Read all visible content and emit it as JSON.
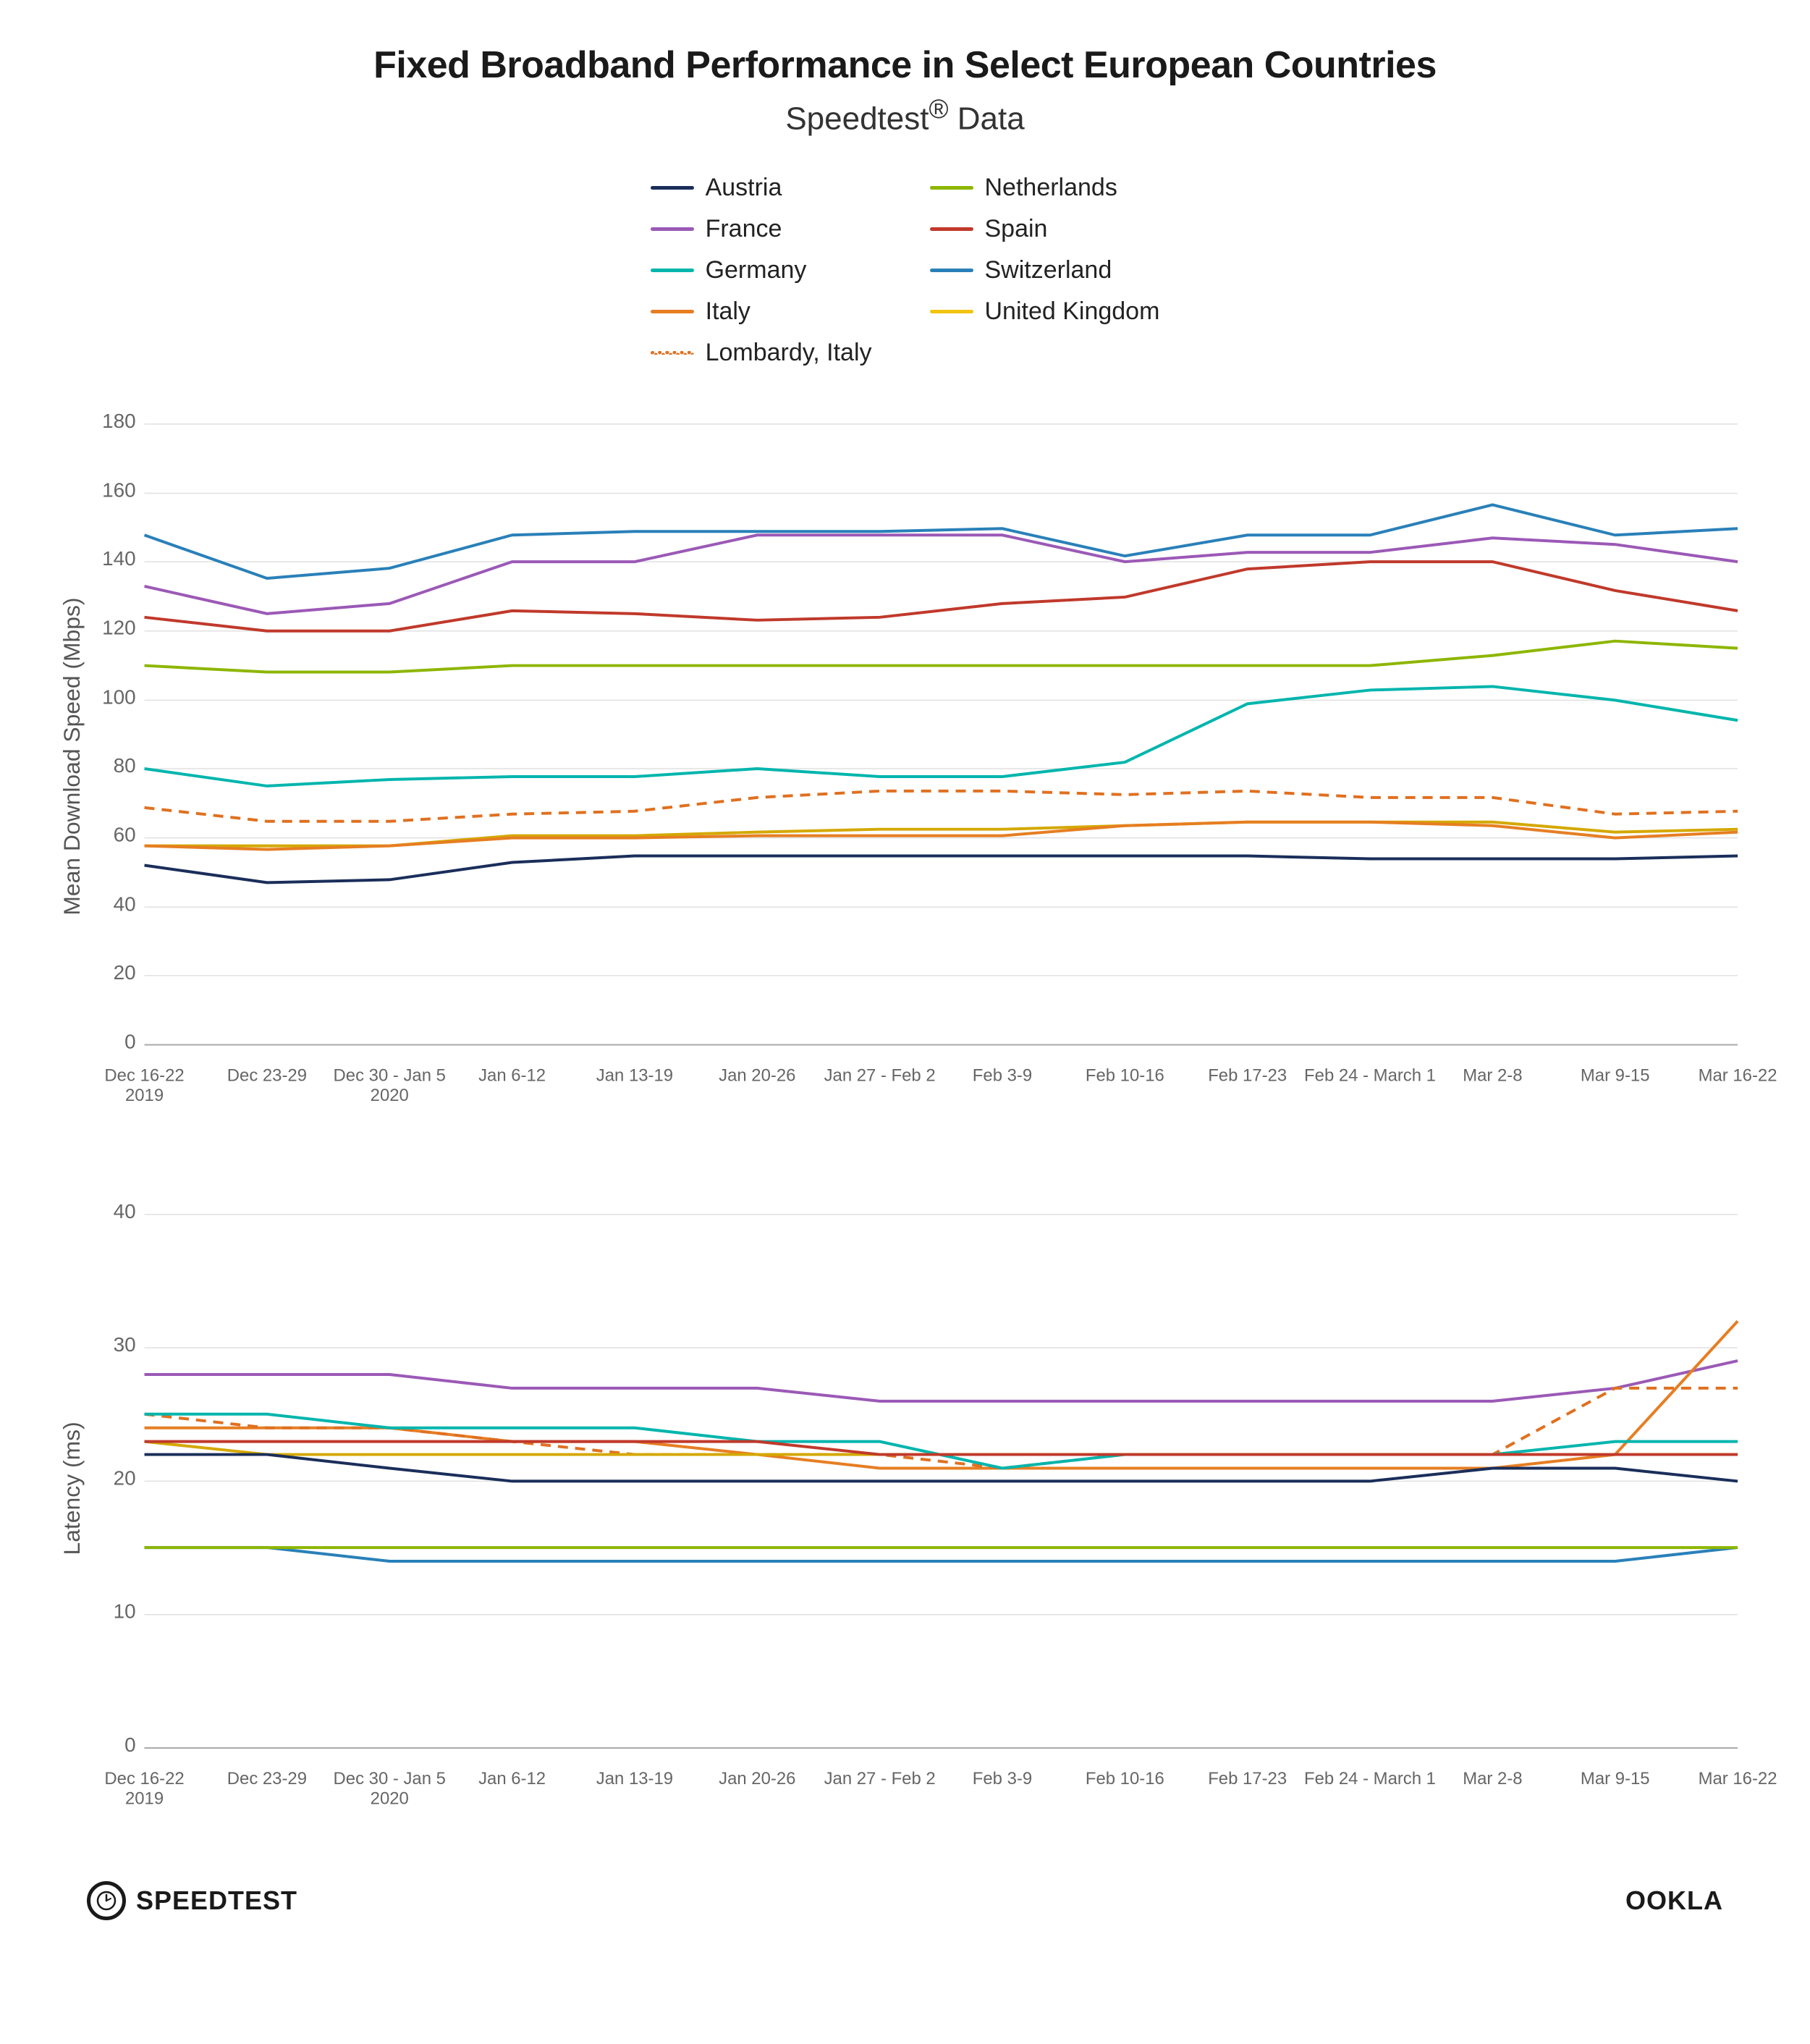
{
  "title": "Fixed Broadband Performance in Select European Countries",
  "subtitle": "Speedtest® Data",
  "legend": {
    "items": [
      {
        "label": "Austria",
        "color": "#1a2e5a",
        "style": "solid"
      },
      {
        "label": "Netherlands",
        "color": "#8db600",
        "style": "solid"
      },
      {
        "label": "France",
        "color": "#9b59b6",
        "style": "solid"
      },
      {
        "label": "Spain",
        "color": "#c0392b",
        "style": "solid"
      },
      {
        "label": "Germany",
        "color": "#00b5ad",
        "style": "solid"
      },
      {
        "label": "Switzerland",
        "color": "#2980b9",
        "style": "solid"
      },
      {
        "label": "Italy",
        "color": "#e67e22",
        "style": "solid"
      },
      {
        "label": "United Kingdom",
        "color": "#f1c40f",
        "style": "solid"
      },
      {
        "label": "Lombardy, Italy",
        "color": "#e07020",
        "style": "dotted"
      }
    ]
  },
  "xLabels": [
    "Dec 16-22\n2019",
    "Dec 23-29",
    "Dec 30 - Jan 5\n2020",
    "Jan 6-12",
    "Jan 13-19",
    "Jan 20-26",
    "Jan 27 - Feb 2",
    "Feb 3-9",
    "Feb 10-16",
    "Feb 17-23",
    "Feb 24 - March 1",
    "Mar 2-8",
    "Mar 9-15",
    "Mar 16-22"
  ],
  "downloadChart": {
    "yLabel": "Mean Download Speed (Mbps)",
    "yMin": 0,
    "yMax": 180,
    "yTicks": [
      0,
      20,
      40,
      60,
      80,
      100,
      120,
      140,
      160,
      180
    ],
    "series": {
      "Austria": [
        52,
        47,
        48,
        53,
        55,
        55,
        55,
        55,
        55,
        55,
        54,
        54,
        54,
        55
      ],
      "France": [
        133,
        125,
        128,
        140,
        140,
        148,
        148,
        148,
        140,
        143,
        143,
        147,
        145,
        140
      ],
      "Germany": [
        80,
        75,
        77,
        78,
        78,
        80,
        78,
        78,
        82,
        98,
        102,
        103,
        100,
        94
      ],
      "Italy": [
        58,
        57,
        58,
        60,
        60,
        61,
        61,
        61,
        64,
        65,
        65,
        64,
        60,
        62
      ],
      "LombardyItaly": [
        69,
        65,
        65,
        67,
        68,
        72,
        74,
        74,
        73,
        74,
        72,
        72,
        67,
        68
      ],
      "Netherlands": [
        110,
        108,
        108,
        110,
        110,
        110,
        110,
        110,
        110,
        110,
        110,
        113,
        117,
        115
      ],
      "Spain": [
        124,
        120,
        120,
        126,
        125,
        123,
        124,
        128,
        130,
        138,
        140,
        140,
        132,
        126
      ],
      "Switzerland": [
        148,
        138,
        140,
        148,
        149,
        149,
        149,
        150,
        143,
        148,
        148,
        157,
        148,
        150
      ],
      "UnitedKingdom": [
        58,
        58,
        58,
        61,
        61,
        62,
        63,
        63,
        64,
        65,
        65,
        65,
        62,
        63
      ]
    }
  },
  "latencyChart": {
    "yLabel": "Latency (ms)",
    "yMin": 0,
    "yMax": 40,
    "yTicks": [
      0,
      10,
      20,
      30,
      40
    ],
    "series": {
      "Austria": [
        22,
        22,
        21,
        20,
        20,
        20,
        20,
        20,
        20,
        20,
        20,
        21,
        21,
        20
      ],
      "France": [
        28,
        28,
        28,
        27,
        27,
        27,
        26,
        26,
        26,
        26,
        26,
        26,
        27,
        29
      ],
      "Germany": [
        25,
        25,
        24,
        24,
        24,
        23,
        23,
        21,
        22,
        22,
        22,
        22,
        23,
        23
      ],
      "Italy": [
        24,
        24,
        24,
        23,
        23,
        22,
        21,
        21,
        21,
        21,
        21,
        21,
        22,
        32
      ],
      "LombardyItaly": [
        25,
        24,
        24,
        23,
        22,
        22,
        22,
        21,
        22,
        22,
        22,
        22,
        27,
        27
      ],
      "Netherlands": [
        15,
        15,
        15,
        15,
        15,
        15,
        15,
        15,
        15,
        15,
        15,
        15,
        15,
        15
      ],
      "Spain": [
        23,
        23,
        23,
        23,
        23,
        23,
        22,
        22,
        22,
        22,
        22,
        22,
        22,
        22
      ],
      "Switzerland": [
        15,
        15,
        14,
        14,
        14,
        14,
        14,
        14,
        14,
        14,
        14,
        14,
        14,
        15
      ],
      "UnitedKingdom": [
        23,
        22,
        22,
        22,
        22,
        22,
        22,
        22,
        22,
        22,
        22,
        22,
        22,
        22
      ]
    }
  },
  "footer": {
    "speedtest_label": "SPEEDTEST",
    "ookla_label": "OOKLA"
  }
}
